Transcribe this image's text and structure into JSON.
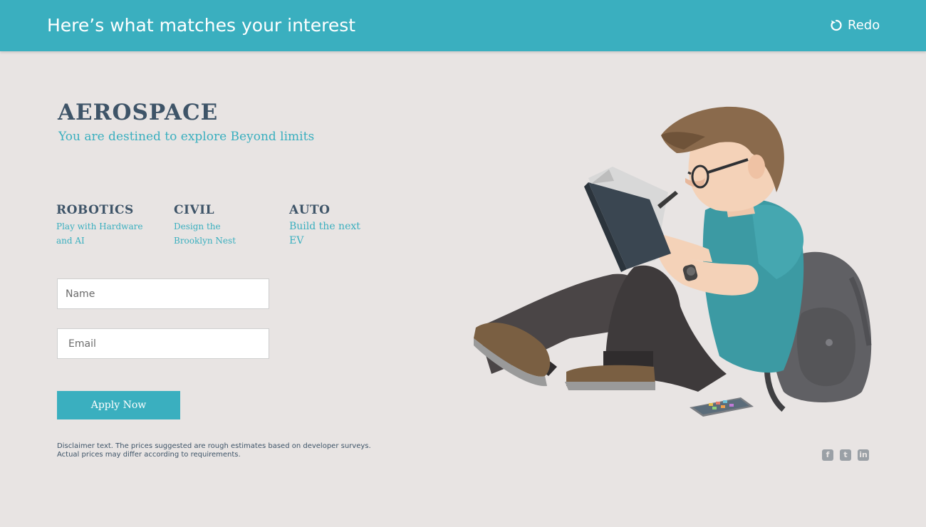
{
  "header": {
    "title": "Here’s what matches your interest",
    "redo_label": "Redo"
  },
  "hero": {
    "title": "AEROSPACE",
    "subtitle": "You are destined to explore Beyond limits"
  },
  "categories": [
    {
      "title": "ROBOTICS",
      "line1": "Play with Hardware",
      "line2": "and AI"
    },
    {
      "title": "CIVIL",
      "line1": "Design the",
      "line2": "Brooklyn Nest"
    },
    {
      "title": "AUTO",
      "line1": "Build the next",
      "line2": "EV"
    }
  ],
  "form": {
    "name_placeholder": "Name",
    "email_placeholder": "Email",
    "apply_label": "Apply Now"
  },
  "disclaimer": {
    "line1": "Disclaimer text. The prices suggested are rough estimates  based on developer surveys.",
    "line2": "Actual prices  may differ according to requirements."
  },
  "social": {
    "facebook_glyph": "f",
    "twitter_glyph": "t",
    "linkedin_glyph": "in"
  },
  "colors": {
    "accent": "#3aafbf",
    "heading": "#3e5468",
    "background": "#e8e4e3"
  }
}
